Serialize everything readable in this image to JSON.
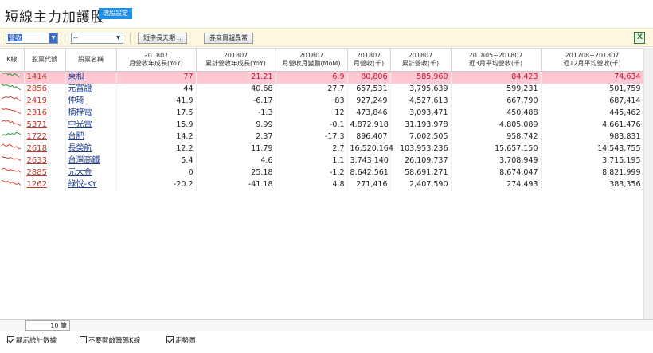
{
  "header": {
    "title": "短線主力加護股",
    "pick_button": "選股設定"
  },
  "toolbar": {
    "category_select": "營收",
    "second_select": "--",
    "button_period": "短中長天期 ..",
    "button_broker": "券商買超異常"
  },
  "table": {
    "columns": [
      {
        "l1": "K線",
        "l2": ""
      },
      {
        "l1": "股票代號",
        "l2": ""
      },
      {
        "l1": "股票名稱",
        "l2": ""
      },
      {
        "l1": "201807",
        "l2": "月營收年成長(YoY)"
      },
      {
        "l1": "201807",
        "l2": "累計營收年成長(YoY)"
      },
      {
        "l1": "201807",
        "l2": "月營收月變動(MoM)"
      },
      {
        "l1": "201807",
        "l2": "月營收(千)"
      },
      {
        "l1": "201807",
        "l2": "累計營收(千)"
      },
      {
        "l1": "201805~201807",
        "l2": "近3月平均營收(千)"
      },
      {
        "l1": "201708~201807",
        "l2": "近12月平均營收(千)"
      }
    ],
    "rows": [
      {
        "code": "1414",
        "name": "東和",
        "yoy": "77",
        "cum_yoy": "21.21",
        "mom": "6.9",
        "rev": "80,806",
        "cum_rev": "585,960",
        "avg3": "84,423",
        "avg12": "74,634",
        "trend": [
          6,
          5,
          6,
          4,
          5,
          3,
          5,
          4,
          2,
          3
        ],
        "trend_color": "#2e9b3a",
        "highlight": true
      },
      {
        "code": "2856",
        "name": "元富證",
        "yoy": "44",
        "cum_yoy": "40.68",
        "mom": "27.7",
        "rev": "657,531",
        "cum_rev": "3,795,639",
        "avg3": "599,231",
        "avg12": "501,759",
        "trend": [
          6,
          5,
          6,
          5,
          4,
          5,
          3,
          4,
          2,
          1
        ],
        "trend_color": "#2e9b3a",
        "highlight": false
      },
      {
        "code": "2419",
        "name": "仲琦",
        "yoy": "41.9",
        "cum_yoy": "-6.17",
        "mom": "83",
        "rev": "927,249",
        "cum_rev": "4,527,613",
        "avg3": "667,790",
        "avg12": "687,414",
        "trend": [
          4,
          5,
          6,
          5,
          6,
          5,
          4,
          5,
          3,
          2
        ],
        "trend_color": "#d14b3a",
        "highlight": false
      },
      {
        "code": "2316",
        "name": "楠梓電",
        "yoy": "17.5",
        "cum_yoy": "-1.3",
        "mom": "12",
        "rev": "473,846",
        "cum_rev": "3,093,471",
        "avg3": "450,488",
        "avg12": "445,462",
        "trend": [
          6,
          5,
          6,
          5,
          5,
          4,
          4,
          3,
          2,
          1
        ],
        "trend_color": "#d14b3a",
        "highlight": false
      },
      {
        "code": "5371",
        "name": "中光電",
        "yoy": "15.9",
        "cum_yoy": "9.99",
        "mom": "-0.1",
        "rev": "4,872,918",
        "cum_rev": "31,193,978",
        "avg3": "4,805,089",
        "avg12": "4,661,476",
        "trend": [
          5,
          6,
          5,
          6,
          4,
          5,
          3,
          3,
          2,
          1
        ],
        "trend_color": "#d14b3a",
        "highlight": false
      },
      {
        "code": "1722",
        "name": "台肥",
        "yoy": "14.2",
        "cum_yoy": "2.37",
        "mom": "-17.3",
        "rev": "896,407",
        "cum_rev": "7,002,505",
        "avg3": "958,742",
        "avg12": "983,831",
        "trend": [
          3,
          4,
          3,
          5,
          4,
          5,
          4,
          6,
          5,
          4
        ],
        "trend_color": "#2e9b3a",
        "highlight": false
      },
      {
        "code": "2618",
        "name": "長榮航",
        "yoy": "12.2",
        "cum_yoy": "11.79",
        "mom": "2.7",
        "rev": "16,520,164",
        "cum_rev": "103,953,236",
        "avg3": "15,657,150",
        "avg12": "14,543,755",
        "trend": [
          5,
          6,
          4,
          5,
          6,
          4,
          3,
          4,
          2,
          2
        ],
        "trend_color": "#d14b3a",
        "highlight": false
      },
      {
        "code": "2633",
        "name": "台灣高鐵",
        "yoy": "5.4",
        "cum_yoy": "4.6",
        "mom": "1.1",
        "rev": "3,743,140",
        "cum_rev": "26,109,737",
        "avg3": "3,708,949",
        "avg12": "3,715,195",
        "trend": [
          6,
          5,
          5,
          4,
          5,
          4,
          3,
          4,
          3,
          2
        ],
        "trend_color": "#d14b3a",
        "highlight": false
      },
      {
        "code": "2885",
        "name": "元大金",
        "yoy": "0",
        "cum_yoy": "25.18",
        "mom": "-1.2",
        "rev": "8,642,561",
        "cum_rev": "58,691,271",
        "avg3": "8,674,047",
        "avg12": "8,821,999",
        "trend": [
          5,
          6,
          5,
          4,
          5,
          4,
          4,
          3,
          4,
          2
        ],
        "trend_color": "#d14b3a",
        "highlight": false
      },
      {
        "code": "1262",
        "name": "綠悅-KY",
        "yoy": "-20.2",
        "cum_yoy": "-41.18",
        "mom": "4.8",
        "rev": "271,416",
        "cum_rev": "2,407,590",
        "avg3": "274,493",
        "avg12": "383,356",
        "trend": [
          6,
          5,
          4,
          5,
          3,
          4,
          3,
          2,
          3,
          1
        ],
        "trend_color": "#d14b3a",
        "highlight": false
      }
    ]
  },
  "footer": {
    "count": "10 筆"
  },
  "options": {
    "show_stats": "顯示統計數據",
    "no_broker": "不要開啟籌碼K線",
    "trend_chart": "走勢圖",
    "show_stats_checked": true,
    "no_broker_checked": false,
    "trend_chart_checked": true
  }
}
